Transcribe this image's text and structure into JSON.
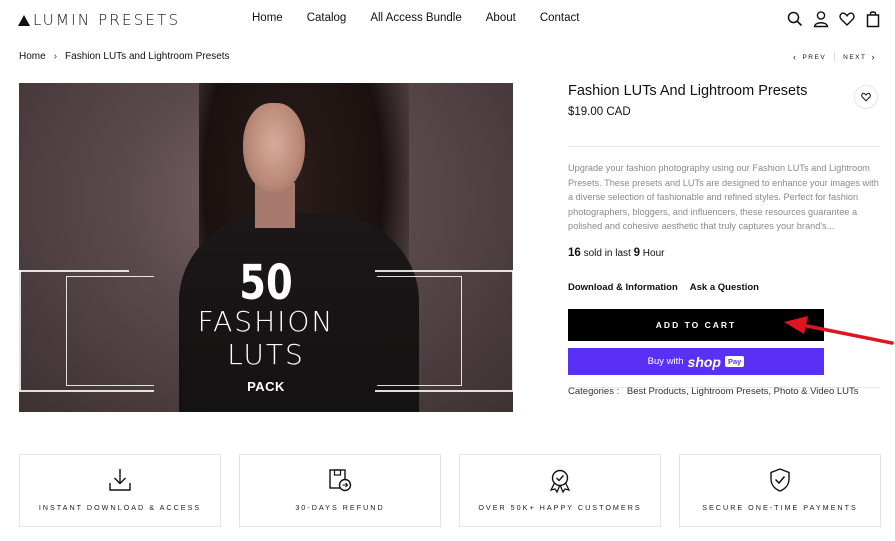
{
  "header": {
    "logo_text": "LUMIN PRESETS",
    "nav": [
      "Home",
      "Catalog",
      "All Access Bundle",
      "About",
      "Contact"
    ],
    "icons": [
      "search-icon",
      "user-icon",
      "heart-icon",
      "cart-icon"
    ]
  },
  "breadcrumb": {
    "home": "Home",
    "separator": "›",
    "current": "Fashion LUTs and Lightroom Presets",
    "prev": "PREV",
    "next": "NEXT"
  },
  "product_image": {
    "number": "50",
    "line1": "FASHION",
    "line2": "LUTS",
    "line3": "PACK"
  },
  "product": {
    "title": "Fashion LUTs And Lightroom Presets",
    "price": "$19.00 CAD",
    "description": "Upgrade your fashion photography using our Fashion LUTs and Lightroom Presets. These presets and LUTs are designed to enhance your images with a diverse selection of fashionable and refined styles. Perfect for fashion photographers, bloggers, and influencers, these resources guarantee a polished and cohesive aesthetic that truly captures your brand's...",
    "sold_count": "16",
    "sold_text_1": "sold in last",
    "sold_hours": "9",
    "sold_text_2": "Hour",
    "link_download": "Download & Information",
    "link_ask": "Ask a Question",
    "add_to_cart": "ADD TO CART",
    "buy_with": "Buy with",
    "shop_word": "shop",
    "pay_badge": "Pay",
    "categories_label": "Categories :",
    "categories": "Best Products, Lightroom Presets, Photo & Video LUTs"
  },
  "features": [
    {
      "label": "INSTANT DOWNLOAD & ACCESS",
      "icon": "download-icon"
    },
    {
      "label": "30-DAYS REFUND",
      "icon": "refund-icon"
    },
    {
      "label": "OVER 50K+ HAPPY CUSTOMERS",
      "icon": "badge-icon"
    },
    {
      "label": "SECURE ONE-TIME PAYMENTS",
      "icon": "shield-check-icon"
    }
  ],
  "colors": {
    "accent_buy": "#5a31f4",
    "cart_bg": "#000000",
    "arrow": "#e0141e"
  }
}
